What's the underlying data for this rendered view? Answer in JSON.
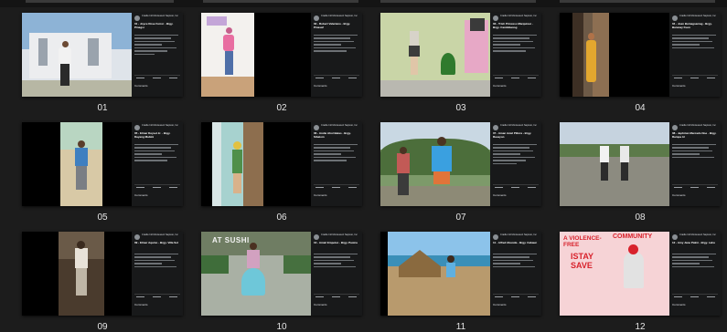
{
  "labels": [
    "01",
    "02",
    "03",
    "04",
    "05",
    "06",
    "07",
    "08"
  ],
  "row3_labels": [
    "09",
    "10",
    "11",
    "12"
  ],
  "posts": {
    "p01": {
      "page": "Cradle Intl Montessori Saptuto, Inc.",
      "title": "01 - Joyce Rose Ferrer - Brgy. Pinagsi"
    },
    "p02": {
      "page": "Cradle Intl Montessori Saptuto, Inc.",
      "title": "02 - Robert Valeriano - Brgy. Pinasaf"
    },
    "p03": {
      "page": "Cradle Intl Montessori Saptuto, Inc.",
      "title": "03 - Trish Princess Marquinez - Brgy. Cambibanog"
    },
    "p04": {
      "page": "Cradle Intl Montessori Saptuto, Inc.",
      "title": "04 - Joan Bumagsamag - Brgy. Baranay Fuen"
    },
    "p05": {
      "page": "Cradle Intl Montessori Saptuto, Inc.",
      "title": "05 - Elmar Deysel Jr. - Brgy. Dayang Mabini"
    },
    "p06": {
      "page": "Cradle Intl Montessori Saptuto, Inc.",
      "title": "06 - Andie Ahol Batas - Brgy. Sibalom"
    },
    "p07": {
      "page": "Cradle Intl Montessori Saptuto, Inc.",
      "title": "07 - Aman Aviel Pillora - Brgy. Rasayon"
    },
    "p08": {
      "page": "Cradle Intl Montessori Saptuto, Inc.",
      "title": "08 - Jephrian Mercado Noe - Brgy. Rampa Al"
    },
    "p09": {
      "page": "Cradle Intl Montessori Saptuto, Inc.",
      "title": "09 - Elmer Aquino - Brgy. Villa Sol"
    },
    "p10": {
      "page": "Cradle Intl Montessori Saptuto, Inc.",
      "title": "10 - Amiel Empetez - Brgy. Pasina"
    },
    "p11": {
      "page": "Cradle Intl Montessori Saptuto, Inc.",
      "title": "11 - Alfred Abunda - Brgy. Cabaun"
    },
    "p12": {
      "page": "Cradle Intl Montessori Saptuto, Inc.",
      "title": "12 - Amy Jane Palmi - Brgy. Lahu"
    }
  },
  "banner_texts": {
    "sushi": "AT SUSHI",
    "violence": "A VIOLENCE-FREE",
    "community": "COMMUNITY",
    "sign": "ISTAY SAVE"
  },
  "comments_label": "Comments",
  "colors": {
    "background": "#1c1c1c",
    "panel": "#18191a",
    "label": "#e6e6e6"
  }
}
